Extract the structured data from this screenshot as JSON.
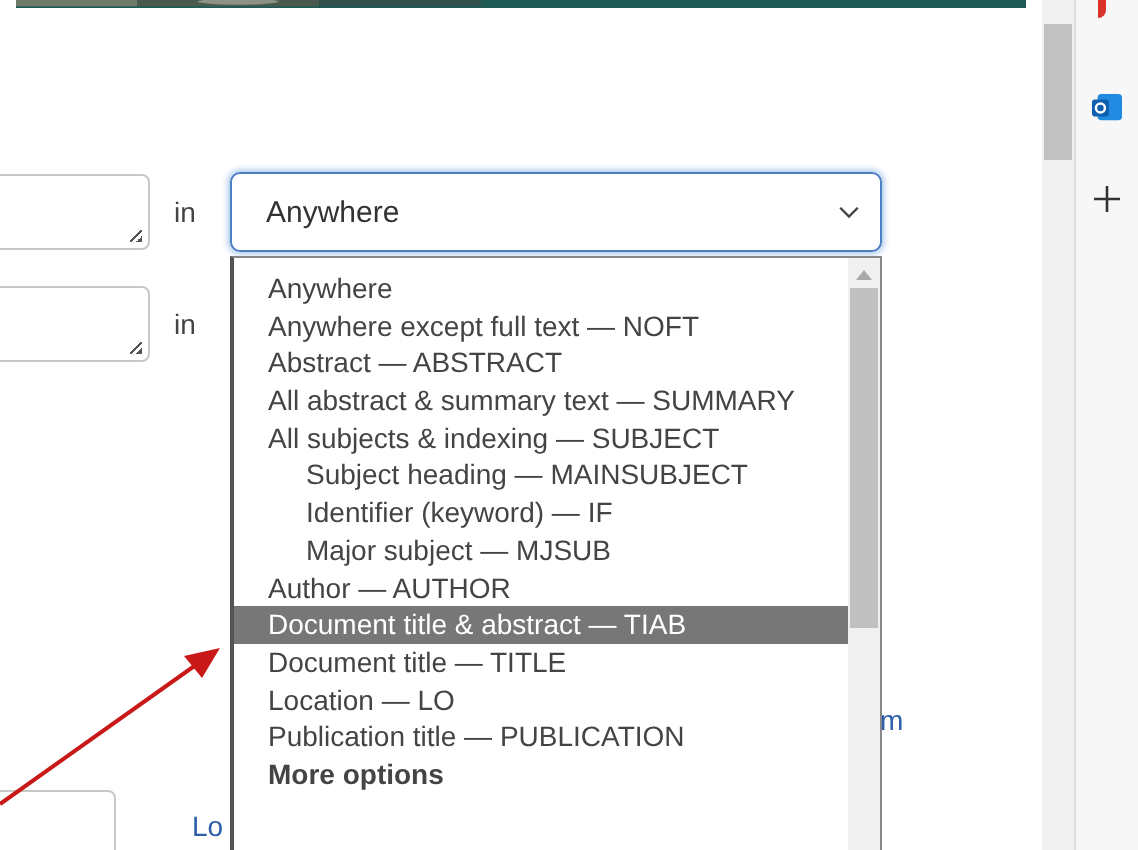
{
  "search_rows": [
    {
      "connector": "in",
      "field": {
        "selected": "Anywhere",
        "open": true
      }
    },
    {
      "connector": "in"
    }
  ],
  "dropdown_options": [
    {
      "label": "Anywhere",
      "kind": "option",
      "selected": false
    },
    {
      "label": "Anywhere except full text — NOFT",
      "kind": "option",
      "selected": false
    },
    {
      "label": "Abstract — ABSTRACT",
      "kind": "option",
      "selected": false
    },
    {
      "label": "All abstract & summary text — SUMMARY",
      "kind": "option",
      "selected": false
    },
    {
      "label": "All subjects & indexing — SUBJECT",
      "kind": "option",
      "selected": false,
      "children": [
        {
          "label": "Subject heading — MAINSUBJECT",
          "kind": "option",
          "selected": false
        },
        {
          "label": "Identifier (keyword) — IF",
          "kind": "option",
          "selected": false
        },
        {
          "label": "Major subject — MJSUB",
          "kind": "option",
          "selected": false
        }
      ]
    },
    {
      "label": "Author — AUTHOR",
      "kind": "option",
      "selected": false
    },
    {
      "label": "Document title & abstract — TIAB",
      "kind": "option",
      "selected": true
    },
    {
      "label": "Document title — TITLE",
      "kind": "option",
      "selected": false
    },
    {
      "label": "Location — LO",
      "kind": "option",
      "selected": false
    },
    {
      "label": "Publication title — PUBLICATION",
      "kind": "option",
      "selected": false
    },
    {
      "label": "More options",
      "kind": "group"
    }
  ],
  "links": [
    {
      "label": "m"
    },
    {
      "label": "Lo"
    }
  ]
}
